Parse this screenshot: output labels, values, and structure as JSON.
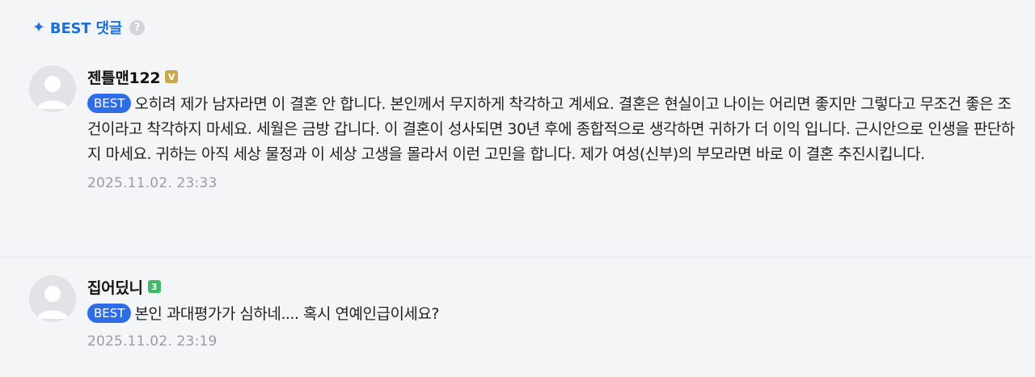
{
  "section": {
    "title": "BEST 댓글",
    "sparkle_icon": "✦",
    "help_icon": "?"
  },
  "comments": [
    {
      "nickname": "젠틀맨122",
      "level_badge": "V",
      "badge_label": "BEST",
      "text": "오히려 제가 남자라면 이 결혼 안 합니다. 본인께서 무지하게 착각하고 계세요. 결혼은 현실이고 나이는 어리면 좋지만 그렇다고 무조건 좋은 조건이라고 착각하지 마세요. 세월은 금방 갑니다. 이 결혼이 성사되면 30년 후에 종합적으로 생각하면 귀하가 더 이익 입니다. 근시안으로 인생을 판단하지 마세요. 귀하는 아직 세상 물정과 이 세상 고생을 몰라서 이런 고민을 합니다. 제가 여성(신부)의 부모라면 바로 이 결혼 추진시킵니다.",
      "timestamp": "2025.11.02. 23:33"
    },
    {
      "nickname": "집어딨니",
      "level_badge": "3",
      "badge_label": "BEST",
      "text": "본인 과대평가가 심하네.... 혹시 연예인급이세요?",
      "timestamp": "2025.11.02. 23:19"
    }
  ],
  "colors": {
    "accent": "#1a6fd8",
    "best_pill": "#2d6ee8",
    "badge_v": "#c9a94a",
    "badge_3": "#3fb86a",
    "background": "#f4f5f7"
  }
}
